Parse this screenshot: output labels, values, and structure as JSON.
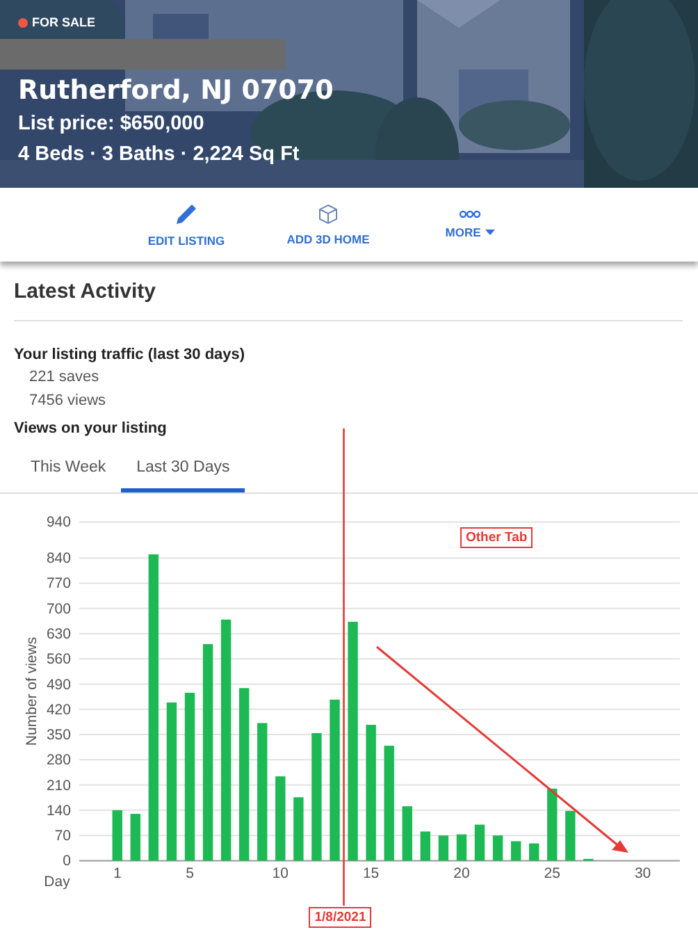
{
  "listing": {
    "status": "FOR SALE",
    "title": "Rutherford, NJ 07070",
    "price": "List price: $650,000",
    "details": "4 Beds · 3 Baths · 2,224 Sq Ft"
  },
  "actions": [
    {
      "kind": "edit",
      "label": "EDIT LISTING"
    },
    {
      "kind": "cube",
      "label": "ADD 3D HOME"
    },
    {
      "kind": "more",
      "label": "MORE"
    }
  ],
  "activity": {
    "heading": "Latest Activity",
    "traffic_heading": "Your listing traffic (last 30 days)",
    "stats": [
      "221 saves",
      "7456 views"
    ],
    "views_heading": "Views on your listing",
    "tabs": [
      {
        "label": "This Week",
        "selected": false
      },
      {
        "label": "Last 30 Days",
        "selected": true
      }
    ],
    "chart_data": {
      "type": "bar",
      "xlabel": "Day",
      "ylabel": "Number of views",
      "x": [
        1,
        2,
        3,
        4,
        5,
        6,
        7,
        8,
        9,
        10,
        11,
        12,
        13,
        14,
        15,
        16,
        17,
        18,
        19,
        20,
        21,
        22,
        23,
        24,
        25,
        26,
        27
      ],
      "series": [
        {
          "color": "#1db954",
          "values": [
            140,
            130,
            850,
            439,
            466,
            601,
            669,
            479,
            382,
            234,
            176,
            354,
            447,
            663,
            377,
            319,
            151,
            81,
            70,
            73,
            100,
            70,
            54,
            48,
            200,
            138,
            5
          ]
        }
      ],
      "xlim": [
        -1.1,
        32.05
      ],
      "ylim": [
        0,
        940
      ],
      "yticks": [
        0,
        70,
        140,
        210,
        280,
        350,
        420,
        490,
        560,
        630,
        700,
        770,
        840,
        940
      ],
      "xticks": [
        1,
        5,
        10,
        15,
        20,
        25,
        30
      ],
      "grid": true
    }
  },
  "markup": [
    {
      "kind": "vline",
      "text": "1/8/2021"
    },
    {
      "kind": "arrow",
      "text": "Other Tab"
    }
  ]
}
